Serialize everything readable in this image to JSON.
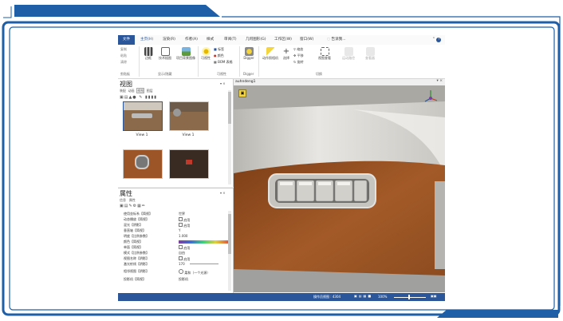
{
  "ribbon_tabs": {
    "file": "文件",
    "items": [
      "主页(H)",
      "渲染(R)",
      "作者(A)",
      "样式",
      "审阅(T)",
      "几何图形(G)",
      "工作区(W)",
      "窗口(W)",
      "告诉我..."
    ],
    "help": "?"
  },
  "ribbon": {
    "paste_group": {
      "items": [
        "复制",
        "粘贴",
        "清除"
      ],
      "label": "剪贴板"
    },
    "display_group": {
      "items": [
        "边框",
        "技术插图",
        "项目背景图像"
      ],
      "label": "显示/隐藏"
    },
    "visibility_group": {
      "items": [
        "可视性",
        "标签",
        "颜色",
        "BOM 表格"
      ],
      "label": "可视性"
    },
    "digger": {
      "item": "Digger",
      "label": "Digger"
    },
    "tools_group": {
      "items": [
        "动作照相机",
        "选择",
        "缩放",
        "平移",
        "旋转",
        "视图查看",
        "运动路径",
        "查看器"
      ],
      "label": "切换"
    }
  },
  "views_panel": {
    "title": "视图",
    "tabs": [
      "装配",
      "动画",
      "视图",
      "图层"
    ],
    "thumbnails": [
      "View 1",
      "View 1",
      "",
      ""
    ]
  },
  "properties_panel": {
    "title": "属性",
    "tabs": [
      "信息",
      "属性"
    ],
    "rows": [
      {
        "key": "使用坐标系【简视】",
        "value": "世界"
      },
      {
        "key": "动态播放【简视】",
        "value": "启用"
      },
      {
        "key": "混光【阴影】",
        "value": "启用"
      },
      {
        "key": "垂直轴【简视】",
        "value": "Y"
      },
      {
        "key": "明度【比例参数】",
        "value": "1.000"
      },
      {
        "key": "颜色【简视】",
        "value": ""
      },
      {
        "key": "单面【简视】",
        "value": "启用"
      },
      {
        "key": "模式【比例参数】",
        "value": "自由"
      },
      {
        "key": "视图名称【阴影】",
        "value": "启用"
      },
      {
        "key": "激光射线【阴影】",
        "value": "170"
      },
      {
        "key": "相邻视图【阴影】",
        "value": "柔和（一个光源）"
      },
      {
        "key": "投影机【简视】",
        "value": "投影机"
      }
    ]
  },
  "document": {
    "tab": "auhndeng1"
  },
  "statusbar": {
    "text": "操作员视图 : 4304",
    "zoom": "100%"
  },
  "colors": {
    "accent": "#2b579a",
    "frame": "#1e5fa8",
    "leather": "#9c5526"
  }
}
